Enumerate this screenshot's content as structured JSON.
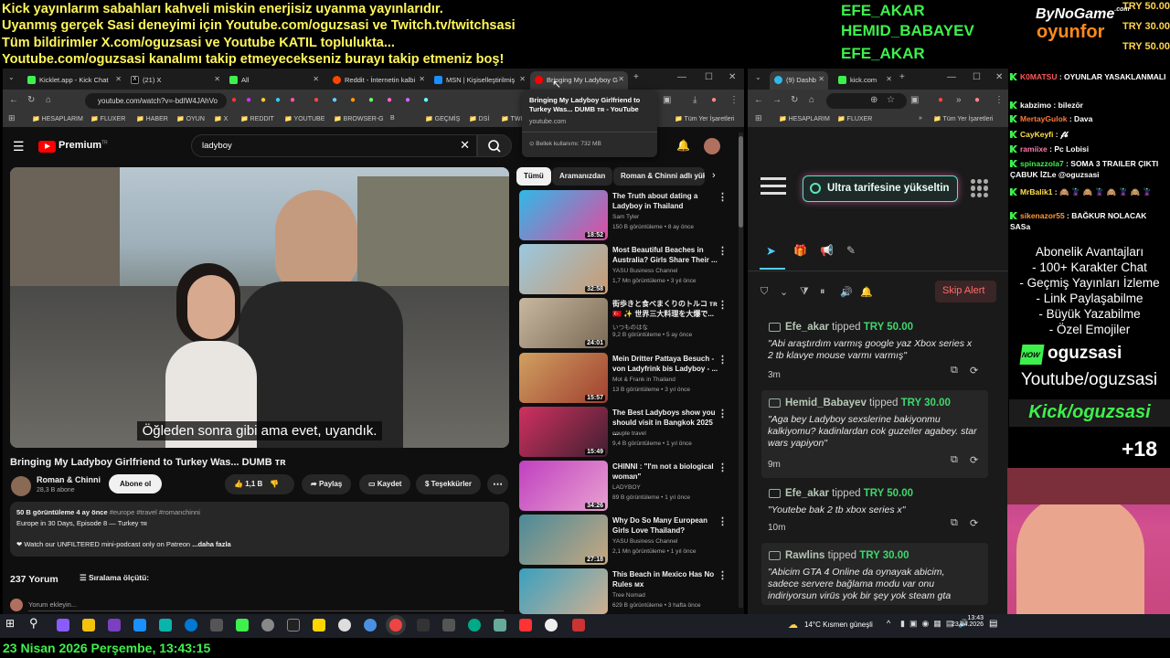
{
  "ticker": {
    "line1": "Kick yayınlarım sabahları kahveli miskin enerjisiz uyanma yayınlarıdır.",
    "line2": "Uyanmış gerçek Sasi deneyimi için Youtube.com/oguzsasi ve Twitch.tv/twitchsasi",
    "line3": "Tüm bildirimler X.com/oguzsasi ve Youtube KATIL toplulukta...",
    "line4": "Youtube.com/oguzsasi kanalımı takip etmeyecekseniz burayı takip etmeniz boş!"
  },
  "top_donors": {
    "d1": "EFE_AKAR",
    "d2": "HEMID_BABAYEV",
    "d3": "EFE_AKAR",
    "amounts": [
      "TRY 50.00",
      "TRY 30.00",
      "TRY 50.00"
    ]
  },
  "sponsor": {
    "line1": "ByNoGame",
    "sup": ".com",
    "line2": "oyunfor"
  },
  "left_browser": {
    "tabs": [
      {
        "label": "Kicklet.app - Kick Chat",
        "color": "#3ef04c"
      },
      {
        "label": "(21) X",
        "color": "#ffffff"
      },
      {
        "label": "All",
        "color": "#3ef04c"
      },
      {
        "label": "Reddit - İnternetin kalbi",
        "color": "#ff4500"
      },
      {
        "label": "MSN | Kişiselleştirilmiş",
        "color": "#1a8fff"
      },
      {
        "label": "Bringing My Ladyboy G",
        "color": "#ff0000"
      }
    ],
    "url": "youtube.com/watch?v=-bdIW4JAhVo",
    "bookmarks": [
      "HESAPLARIM",
      "FLUXER",
      "HABER",
      "OYUN",
      "X",
      "REDDIT",
      "YOUTUBE",
      "BROWSER-G",
      "B",
      "GEÇMİŞ",
      "DSİ",
      "TWI"
    ],
    "all_bookmarks": "Tüm Yer İşaretleri",
    "tooltip": {
      "title": "Bringing My Ladyboy Girlfriend to Turkey Was... DUMB ᴛʀ - YouTube",
      "domain": "youtube.com",
      "memory": "Bellek kullanımı: 732 MB"
    }
  },
  "youtube": {
    "logo": "Premium",
    "logo_sup": "TR",
    "search": "ladyboy",
    "subtitle": "Öğleden sonra gibi ama evet, uyandık.",
    "video_title": "Bringing My Ladyboy Girlfriend to Turkey Was... DUMB ᴛʀ",
    "channel": "Roman & Chinni",
    "subs": "28,3 B abone",
    "subscribe": "Abone ol",
    "likes": "1,1 B",
    "share": "Paylaş",
    "save": "Kaydet",
    "thanks": "Teşekkürler",
    "desc_views": "50 B görüntüleme  4 ay önce",
    "desc_tags": "#europe #travel #romanchinni",
    "desc_line2": "Europe in 30 Days, Episode 8 — Turkey ᴛʀ",
    "desc_line3": "❤ Watch our UNFILTERED mini-podcast only on Patreon",
    "desc_more": "...daha fazla",
    "comments": "237 Yorum",
    "sort": "Sıralama ölçütü:",
    "add_comment": "Yorum ekleyin...",
    "chips": [
      "Tümü",
      "Aramanızdan",
      "Roman & Chinni adlı yük"
    ],
    "recs": [
      {
        "title": "The Truth about dating a Ladyboy in Thailand",
        "channel": "Sam Tyler",
        "meta": "150 B görüntüleme • 8 ay önce",
        "dur": "18:52",
        "c1": "#2fb9e8",
        "c2": "#e14aa0"
      },
      {
        "title": "Most Beautiful Beaches in Australia? Girls Share Their ...",
        "channel": "YASU Business Channel",
        "meta": "1,7 Mn görüntüleme • 3 yıl önce",
        "dur": "32:58",
        "c1": "#9ac8e0",
        "c2": "#c89a70"
      },
      {
        "title": "街歩きと食べまくりのトルコ ᴛʀ 🇹🇷 ✨ 世界三大料理を大爆で...",
        "channel": "いつものはな",
        "meta": "9,2 B görüntüleme • 5 ay önce",
        "dur": "24:01",
        "c1": "#c8b8a0",
        "c2": "#7a6a55"
      },
      {
        "title": "Mein Dritter Pattaya Besuch - von Ladyfrink bis Ladyboy - ...",
        "channel": "Mot & Frank in Thailand",
        "meta": "13 B görüntüleme • 3 yıl önce",
        "dur": "15:57",
        "c1": "#d0a060",
        "c2": "#a04030"
      },
      {
        "title": "The Best Ladyboys show you should visit  in Bangkok 2025 ...",
        "channel": "couple travel",
        "meta": "9,4 B görüntüleme • 1 yıl önce",
        "dur": "15:49",
        "c1": "#d03060",
        "c2": "#402030"
      },
      {
        "title": "CHINNI : \"I'm not a biological woman\"",
        "channel": "LADYBOY",
        "meta": "89 B görüntüleme • 1 yıl önce",
        "dur": "34:26",
        "c1": "#c040c0",
        "c2": "#e8a0d0"
      },
      {
        "title": "Why Do So Many European Girls Love Thailand?",
        "channel": "YASU Business Channel",
        "meta": "2,1 Mn görüntüleme • 1 yıl önce",
        "dur": "27:18",
        "c1": "#4a8a9a",
        "c2": "#c8a880"
      },
      {
        "title": "This Beach in Mexico Has No Rules ᴍx",
        "channel": "Tree Nomad",
        "meta": "629 B görüntüleme • 3 hafta önce",
        "dur": "",
        "c1": "#3aa0c0",
        "c2": "#d0b090"
      }
    ]
  },
  "right_browser": {
    "tabs": [
      {
        "label": "(9) Dashb",
        "color": "#2fb9e8"
      },
      {
        "label": "kick.com",
        "color": "#3ef04c"
      }
    ],
    "bookmarks": [
      "HESAPLARIM",
      "FLUXER"
    ],
    "all_bookmarks": "Tüm Yer İşaretleri",
    "upgrade": "Ultra tarifesine yükseltin",
    "skip": "Skip Alert",
    "alerts": [
      {
        "name": "Efe_akar",
        "verb": " tipped ",
        "amount": "TRY 50.00",
        "msg": "\"Abi araştırdım varmış google yaz Xbox series x 2 tb klavye mouse varmı varmış\"",
        "time": "3m"
      },
      {
        "name": "Hemid_Babayev",
        "verb": " tipped ",
        "amount": "TRY 30.00",
        "msg": "\"Aga bey Ladyboy sexslerine bakiyonmu kalkiyomu? kadinlardan cok guzeller agabey. star wars yapiyon\"",
        "time": "9m"
      },
      {
        "name": "Efe_akar",
        "verb": " tipped ",
        "amount": "TRY 50.00",
        "msg": "\"Youtebe bak 2 tb xbox series x\"",
        "time": "10m"
      },
      {
        "name": "Rawlins",
        "verb": " tipped ",
        "amount": "TRY 30.00",
        "msg": "\"Abicim GTA 4 Online da oynayak abicim, sadece servere bağlama modu var onu indiriyorsun virüs yok bir şey yok steam gta",
        "time": ""
      }
    ]
  },
  "chat": [
    {
      "user": "K0MATSU",
      "msg": " : OYUNLAR YASAKLANMALI",
      "color": "#ff5a5a"
    },
    {
      "user": "kabzimo",
      "msg": " : bilezör",
      "color": "#ffffff"
    },
    {
      "user": "MertayGulok",
      "msg": " : Dava",
      "color": "#ff7a3a"
    },
    {
      "user": "CayKeyfi",
      "msg": " : 𝓯𝓫",
      "color": "#ffe04a"
    },
    {
      "user": "ramiixe",
      "msg": " : Pc Lobisi",
      "color": "#ff7ab0"
    },
    {
      "user": "spinazzola7",
      "msg": " : SOMA 3 TRAILER ÇIKTI ÇABUK İZLe @oguzsasi",
      "color": "#3ef04c"
    },
    {
      "user": "MrBalik1",
      "msg": " : 🙈 🦹 🙈 🦹 🙈 🦹 🙈 🦹",
      "color": "#ffe04a"
    },
    {
      "user": "sikenazor55",
      "msg": " : BAĞKUR NOLACAK SASa",
      "color": "#ff9a3a"
    }
  ],
  "benefits": {
    "title": "Abonelik Avantajları",
    "items": [
      "- 100+ Karakter Chat",
      "- Geçmiş Yayınları İzleme",
      "- Link Paylaşabilme",
      "- Büyük Yazabilme",
      "- Özel Emojiler"
    ],
    "now": "NOW",
    "brand": "oguzsasi",
    "yt": "Youtube/oguzsasi",
    "kick": "Kick/oguzsasi",
    "age": "+18"
  },
  "taskbar": {
    "weather": "14°C",
    "weather_text": "Kısmen güneşli",
    "time": "13:43",
    "date": "23.04.2026"
  },
  "bottom_clock": "23 Nisan 2026 Perşembe, 13:43:15"
}
